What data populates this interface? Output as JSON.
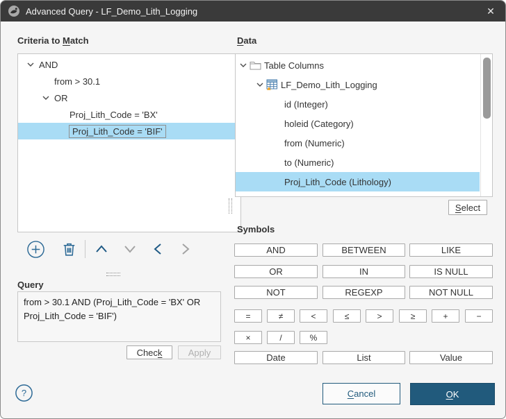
{
  "window": {
    "title": "Advanced Query - LF_Demo_Lith_Logging",
    "close_glyph": "✕"
  },
  "criteria": {
    "label": {
      "pre": "Criteria to ",
      "u": "M",
      "post": "atch"
    },
    "tree": [
      {
        "text": "AND",
        "expanded": true
      },
      {
        "text": "from > 30.1"
      },
      {
        "text": "OR",
        "expanded": true
      },
      {
        "text": "Proj_Lith_Code = 'BX'"
      },
      {
        "text": "Proj_Lith_Code = 'BIF'",
        "selected": true
      }
    ]
  },
  "query": {
    "label": "Query",
    "text": "from > 30.1 AND (Proj_Lith_Code = 'BX' OR Proj_Lith_Code = 'BIF')",
    "check": {
      "pre": "Chec",
      "u": "k",
      "post": ""
    },
    "apply": "Apply"
  },
  "data_panel": {
    "label": {
      "pre": "",
      "u": "D",
      "post": "ata"
    },
    "tree": [
      {
        "text": "Table Columns",
        "icon": "folder-icon",
        "expanded": true
      },
      {
        "text": "LF_Demo_Lith_Logging",
        "icon": "table-icon",
        "expanded": true
      },
      {
        "text": "id (Integer)"
      },
      {
        "text": "holeid (Category)"
      },
      {
        "text": "from (Numeric)"
      },
      {
        "text": "to (Numeric)"
      },
      {
        "text": "Proj_Lith_Code (Lithology)",
        "selected": true
      }
    ],
    "select": {
      "pre": "",
      "u": "S",
      "post": "elect"
    }
  },
  "symbols": {
    "label": "Symbols",
    "logical": [
      "AND",
      "BETWEEN",
      "LIKE",
      "OR",
      "IN",
      "IS NULL",
      "NOT",
      "REGEXP",
      "NOT NULL"
    ],
    "comparison": [
      "=",
      "≠",
      "<",
      "≤",
      ">",
      "≥",
      "+",
      "−"
    ],
    "arithmetic": [
      "×",
      "/",
      "%"
    ],
    "values": [
      "Date",
      "List",
      "Value"
    ]
  },
  "footer": {
    "help": "?",
    "cancel": {
      "pre": "",
      "u": "C",
      "post": "ancel"
    },
    "ok": {
      "pre": "",
      "u": "O",
      "post": "K"
    }
  },
  "colors": {
    "titlebar": "#3a3a3a",
    "accent_blue": "#215a7c",
    "icon_blue": "#2d6a96",
    "selection_blue": "#a9dcf5",
    "disabled_gray": "#9e9e9e",
    "table_icon_warning": "#f5a623"
  }
}
